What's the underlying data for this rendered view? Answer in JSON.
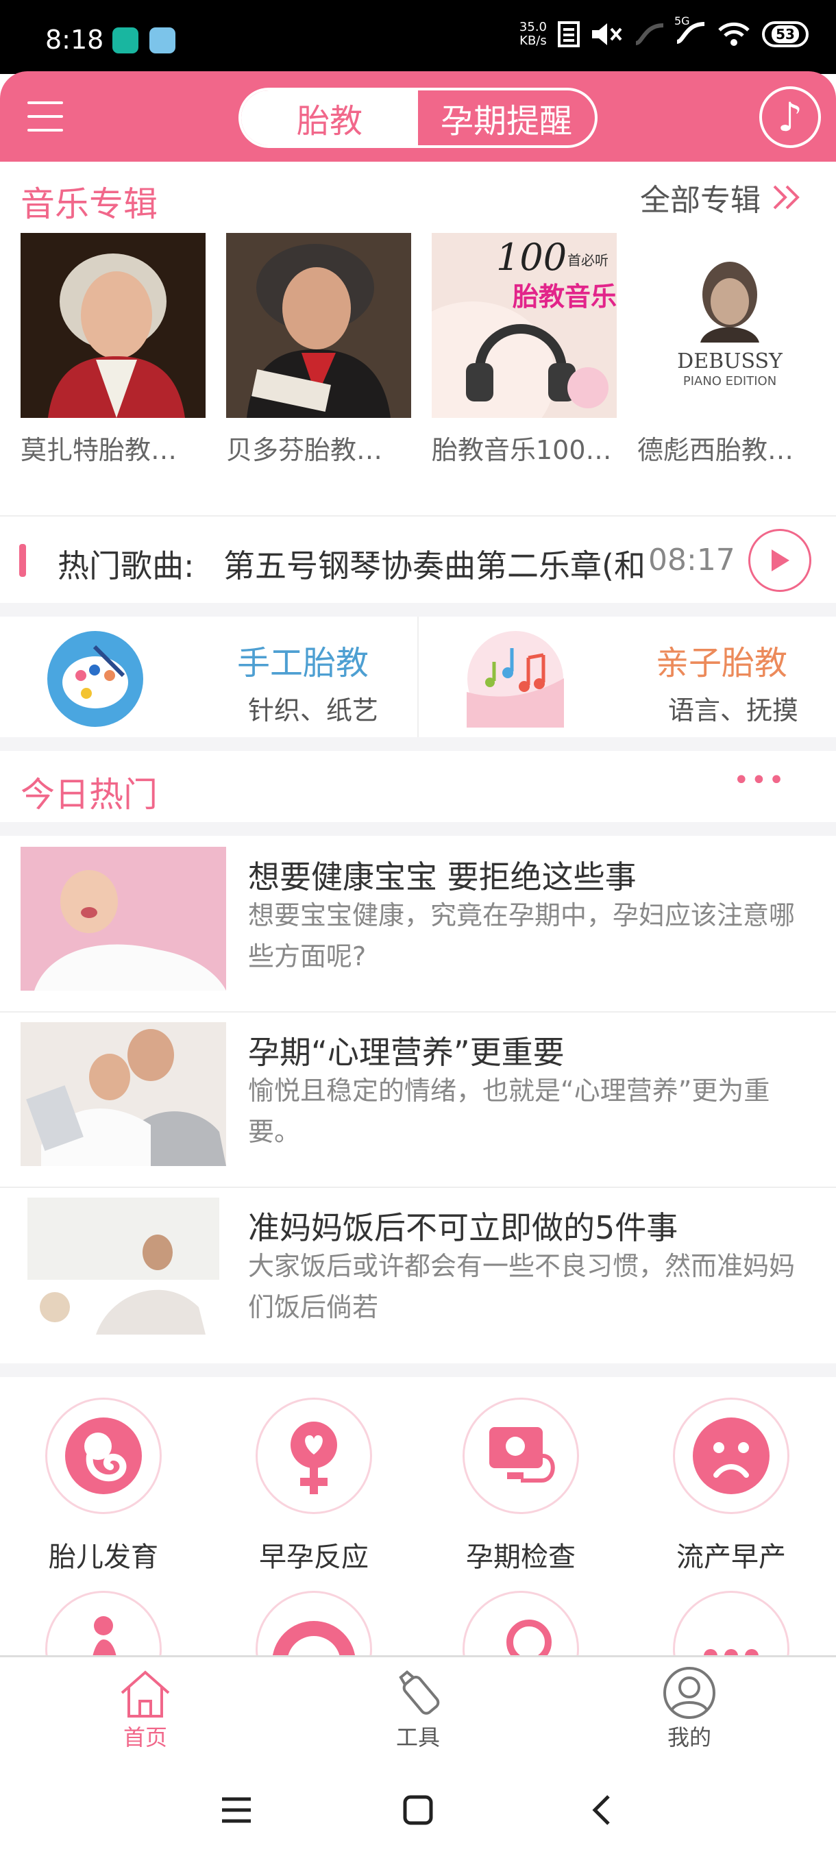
{
  "status_bar": {
    "time": "8:18",
    "net_speed_top": "35.0",
    "net_speed_unit": "KB/s",
    "network": "5G",
    "battery": "53"
  },
  "header": {
    "tab_active": "胎教",
    "tab_other": "孕期提醒"
  },
  "albums": {
    "title": "音乐专辑",
    "more": "全部专辑",
    "items": [
      {
        "caption": "莫扎特胎教…"
      },
      {
        "caption": "贝多芬胎教…"
      },
      {
        "caption": "胎教音乐100…",
        "cover_text_top": "100",
        "cover_text_small": "首必听",
        "cover_text_main": "胎教音乐"
      },
      {
        "caption": "德彪西胎教…",
        "cover_text_top": "DEBUSSY",
        "cover_text_sub": "PIANO EDITION"
      }
    ]
  },
  "hot_song": {
    "label": "热门歌曲:",
    "song": "第五号钢琴协奏曲第二乐章(和",
    "duration": "08:17"
  },
  "features": [
    {
      "title": "手工胎教",
      "subtitle": "针织、纸艺",
      "color": "#4d9fd2"
    },
    {
      "title": "亲子胎教",
      "subtitle": "语言、抚摸",
      "color": "#ec8a5a"
    }
  ],
  "today": {
    "title": "今日热门",
    "more": "•••",
    "articles": [
      {
        "title": "想要健康宝宝 要拒绝这些事",
        "summary": "想要宝宝健康，究竟在孕期中，孕妇应该注意哪些方面呢?"
      },
      {
        "title": "孕期“心理营养”更重要",
        "summary": "愉悦且稳定的情绪，也就是“心理营养”更为重要。"
      },
      {
        "title": "准妈妈饭后不可立即做的5件事",
        "summary": "大家饭后或许都会有一些不良习惯，然而准妈妈们饭后倘若"
      }
    ]
  },
  "categories": [
    {
      "label": "胎儿发育",
      "icon": "fetus-icon"
    },
    {
      "label": "早孕反应",
      "icon": "female-heart-icon"
    },
    {
      "label": "孕期检查",
      "icon": "ultrasound-icon"
    },
    {
      "label": "流产早产",
      "icon": "sad-face-icon"
    }
  ],
  "bottom_nav": [
    {
      "label": "首页",
      "active": true
    },
    {
      "label": "工具",
      "active": false
    },
    {
      "label": "我的",
      "active": false
    }
  ],
  "colors": {
    "accent": "#f1678a",
    "blue": "#4d9fd2",
    "orange": "#ec8a5a"
  }
}
